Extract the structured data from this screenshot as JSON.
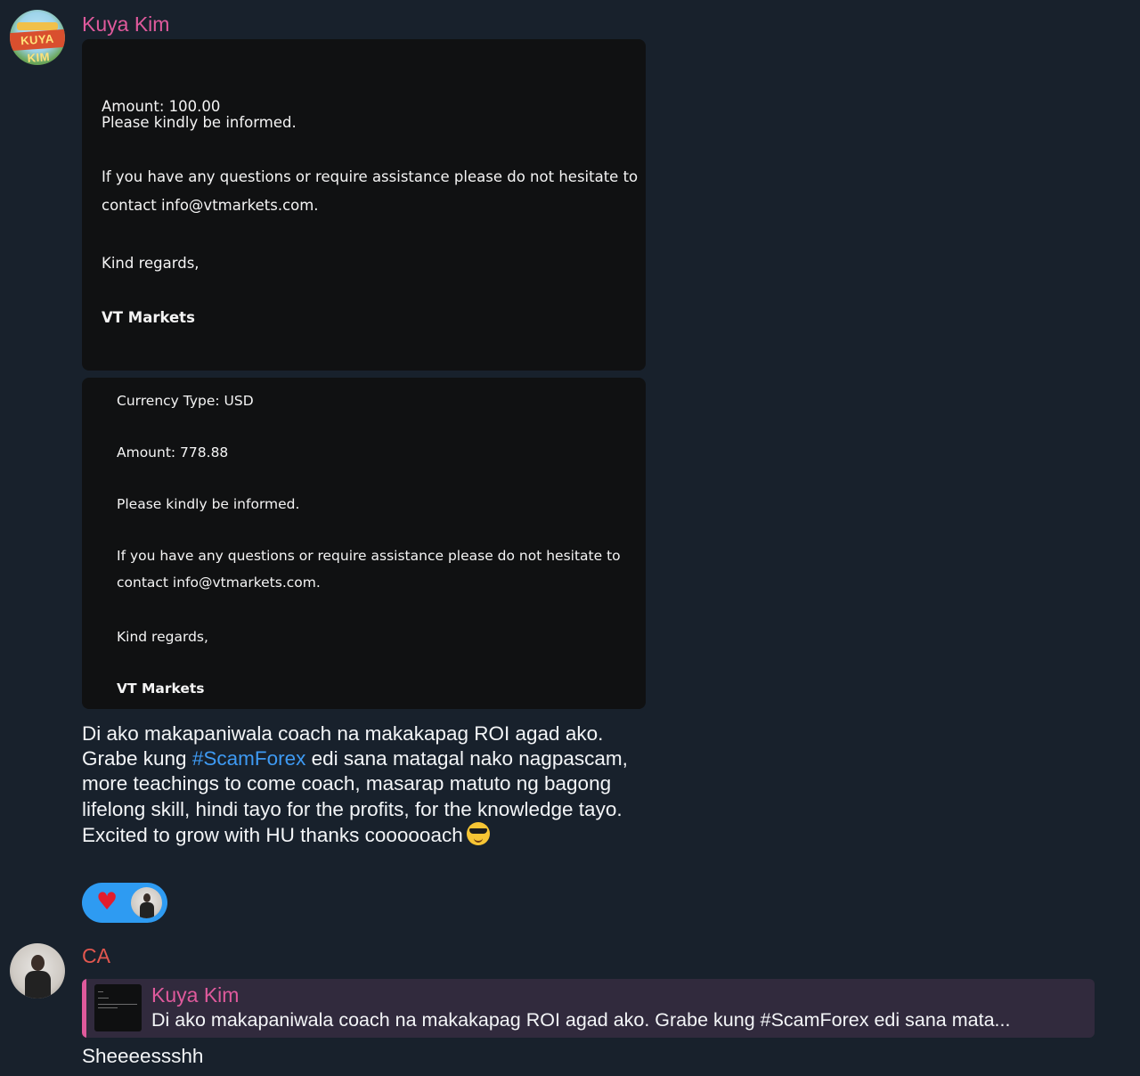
{
  "messages": [
    {
      "sender": "Kuya Kim",
      "avatar_logo": "KUYA KIM",
      "photo1": {
        "lines": [
          "Amount: 100.00",
          "Please kindly be informed.",
          "If you have any questions or require assistance please do not hesitate to",
          "contact info@vtmarkets.com.",
          "Kind regards,",
          "VT Markets"
        ]
      },
      "photo2": {
        "lines": [
          "Currency Type: USD",
          "Amount: 778.88",
          "Please kindly be informed.",
          "If you have any questions or require assistance please do not hesitate to",
          "contact info@vtmarkets.com.",
          "Kind regards,",
          "VT Markets"
        ]
      },
      "text_part1": "Di ako makapaniwala coach na makakapag ROI agad ako. Grabe kung ",
      "hashtag": "#ScamForex",
      "text_part2": " edi sana matagal nako nagpascam, more teachings to come coach, masarap matuto ng bagong lifelong skill, hindi tayo for the profits, for the knowledge tayo. Excited to grow with HU thanks coooooach",
      "emoji": "smiling-face-with-sunglasses",
      "reaction": {
        "emoji": "♥"
      }
    },
    {
      "sender": "CA",
      "reply": {
        "name": "Kuya Kim",
        "preview": "Di ako makapaniwala coach na makakapag ROI agad ako. Grabe kung #ScamForex edi sana mata..."
      },
      "text": "Sheeeessshh"
    }
  ],
  "colors": {
    "background": "#18212c",
    "sender_kim": "#df5a9c",
    "sender_ca": "#e2574f",
    "hashtag": "#3e9af3",
    "reaction_bg": "#2e9bf2",
    "reply_bg": "#312a3d"
  }
}
